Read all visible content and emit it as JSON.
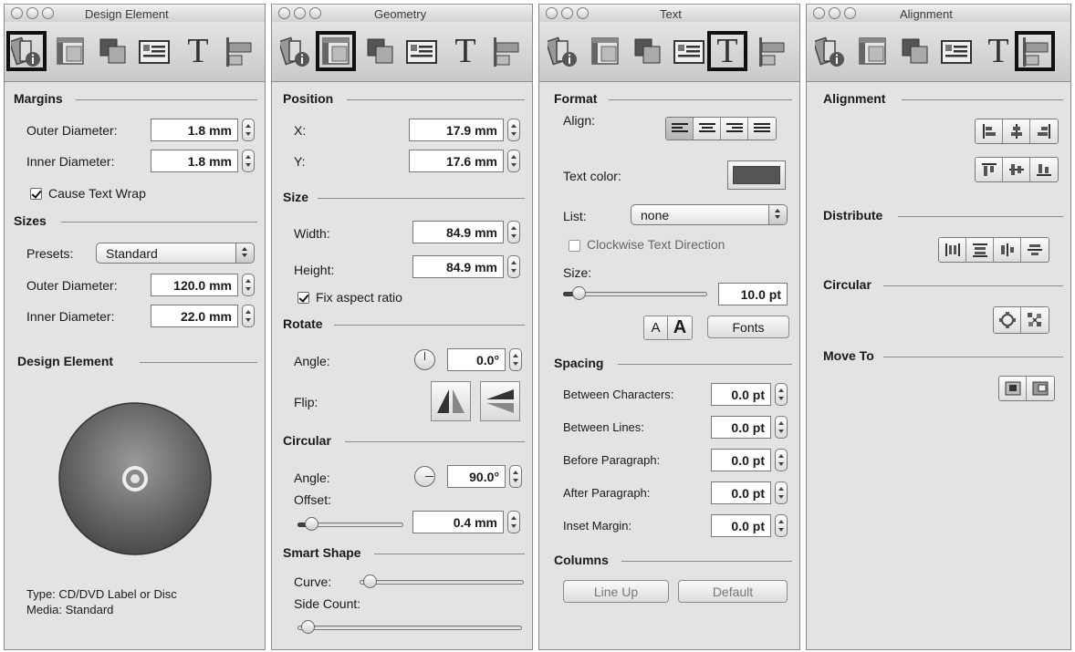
{
  "panels": {
    "design_element": {
      "title": "Design Element",
      "margins": {
        "header": "Margins",
        "outer_label": "Outer Diameter:",
        "outer_value": "1.8 mm",
        "inner_label": "Inner Diameter:",
        "inner_value": "1.8 mm",
        "wrap_label": "Cause Text Wrap",
        "wrap_checked": true
      },
      "sizes": {
        "header": "Sizes",
        "presets_label": "Presets:",
        "presets_value": "Standard",
        "outer_label": "Outer Diameter:",
        "outer_value": "120.0 mm",
        "inner_label": "Inner Diameter:",
        "inner_value": "22.0 mm"
      },
      "preview": {
        "header": "Design Element",
        "type_text": "Type: CD/DVD Label or Disc",
        "media_text": "Media: Standard"
      }
    },
    "geometry": {
      "title": "Geometry",
      "position": {
        "header": "Position",
        "x_label": "X:",
        "x_value": "17.9 mm",
        "y_label": "Y:",
        "y_value": "17.6 mm"
      },
      "size": {
        "header": "Size",
        "width_label": "Width:",
        "width_value": "84.9 mm",
        "height_label": "Height:",
        "height_value": "84.9 mm",
        "aspect_label": "Fix aspect ratio",
        "aspect_checked": true
      },
      "rotate": {
        "header": "Rotate",
        "angle_label": "Angle:",
        "angle_value": "0.0°",
        "flip_label": "Flip:"
      },
      "circular": {
        "header": "Circular",
        "angle_label": "Angle:",
        "angle_value": "90.0°",
        "offset_label": "Offset:",
        "offset_value": "0.4 mm"
      },
      "smart_shape": {
        "header": "Smart Shape",
        "curve_label": "Curve:",
        "side_count_label": "Side Count:"
      }
    },
    "text": {
      "title": "Text",
      "format": {
        "header": "Format",
        "align_label": "Align:",
        "text_color_label": "Text color:",
        "text_color_value": "#555555",
        "list_label": "List:",
        "list_value": "none",
        "clockwise_label": "Clockwise Text Direction",
        "clockwise_checked": false,
        "size_label": "Size:",
        "size_value": "10.0 pt",
        "font_small": "A",
        "font_large": "A",
        "fonts_button": "Fonts"
      },
      "spacing": {
        "header": "Spacing",
        "rows": [
          {
            "label": "Between Characters:",
            "value": "0.0 pt"
          },
          {
            "label": "Between Lines:",
            "value": "0.0 pt"
          },
          {
            "label": "Before Paragraph:",
            "value": "0.0 pt"
          },
          {
            "label": "After Paragraph:",
            "value": "0.0 pt"
          },
          {
            "label": "Inset Margin:",
            "value": "0.0 pt"
          }
        ]
      },
      "columns": {
        "header": "Columns",
        "line_up_button": "Line Up",
        "default_button": "Default"
      }
    },
    "alignment": {
      "title": "Alignment",
      "alignment_header": "Alignment",
      "distribute_header": "Distribute",
      "circular_header": "Circular",
      "move_to_header": "Move To"
    }
  },
  "toolbar_icons": [
    "design-element-icon",
    "geometry-icon",
    "fill-stroke-icon",
    "image-icon",
    "text-icon",
    "alignment-icon"
  ]
}
